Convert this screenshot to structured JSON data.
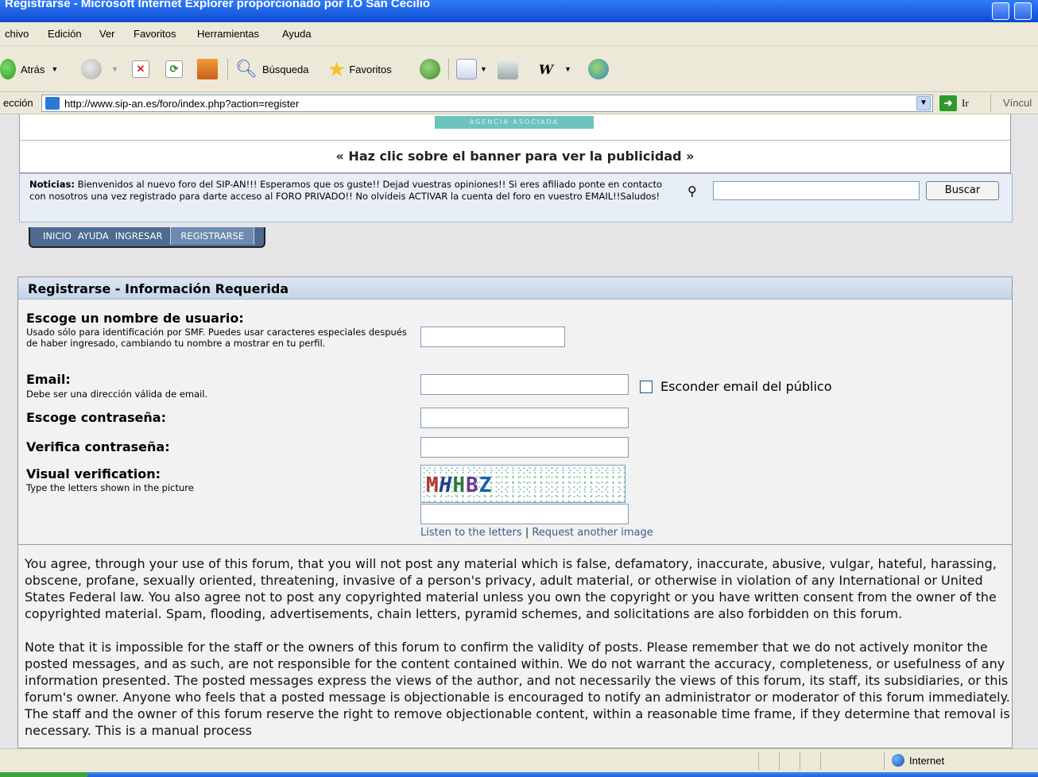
{
  "window": {
    "title": "Registrarse - Microsoft Internet Explorer proporcionado por I.O San Cecilio"
  },
  "menu": [
    "chivo",
    "Edición",
    "Ver",
    "Favoritos",
    "Herramientas",
    "Ayuda"
  ],
  "toolbar": {
    "back": "Atrás",
    "search": "Búsqueda",
    "favorites": "Favoritos"
  },
  "address": {
    "label": "ección",
    "url": "http://www.sip-an.es/foro/index.php?action=register",
    "go": "Ir",
    "links": "Víncul"
  },
  "banner": {
    "strip": "AGENCIA ASOCIADA",
    "message": "« Haz clic sobre el banner para ver la publicidad »"
  },
  "news": {
    "label": "Noticias:",
    "text": " Bienvenidos al nuevo foro del SIP-AN!!! Esperamos que os guste!! Dejad vuestras opiniones!! Si eres afiliado ponte en contacto con nosotros una vez registrado para darte acceso al FORO PRIVADO!! No olvideis ACTIVAR la cuenta del foro en vuestro EMAIL!!Saludos!",
    "search_button": "Buscar"
  },
  "tabs": [
    "INICIO",
    "AYUDA",
    "INGRESAR",
    "REGISTRARSE"
  ],
  "form": {
    "header": "Registrarse - Información Requerida",
    "username": {
      "title": "Escoge un nombre de usuario:",
      "desc": "Usado sólo para identificación por SMF. Puedes usar caracteres especiales después de haber ingresado, cambiando tu nombre a mostrar en tu perfil."
    },
    "email": {
      "title": "Email:",
      "desc": "Debe ser una dirección válida de email.",
      "hide_label": "Esconder email del público"
    },
    "password": {
      "title": "Escoge contraseña:"
    },
    "verify": {
      "title": "Verifica contraseña:"
    },
    "visual": {
      "title": "Visual verification:",
      "desc": "Type the letters shown in the picture",
      "captcha": "MHHBZ"
    },
    "links": {
      "listen": "Listen to the letters",
      "separator": "|",
      "another": "Request another image"
    }
  },
  "agreement": [
    "You agree, through your use of this forum, that you will not post any material which is false, defamatory, inaccurate, abusive, vulgar, hateful, harassing, obscene, profane, sexually oriented, threatening, invasive of a person's privacy, adult material, or otherwise in violation of any International or United States Federal law. You also agree not to post any copyrighted material unless you own the copyright or you have written consent from the owner of the copyrighted material. Spam, flooding, advertisements, chain letters, pyramid schemes, and solicitations are also forbidden on this forum.",
    "Note that it is impossible for the staff or the owners of this forum to confirm the validity of posts. Please remember that we do not actively monitor the posted messages, and as such, are not responsible for the content contained within. We do not warrant the accuracy, completeness, or usefulness of any information presented. The posted messages express the views of the author, and not necessarily the views of this forum, its staff, its subsidiaries, or this forum's owner. Anyone who feels that a posted message is objectionable is encouraged to notify an administrator or moderator of this forum immediately. The staff and the owner of this forum reserve the right to remove objectionable content, within a reasonable time frame, if they determine that removal is necessary. This is a manual process"
  ],
  "status": {
    "zone": "Internet"
  },
  "colors": {
    "tab_bar": "#4d6a91",
    "link": "#3a5a8a",
    "header_bg": "#c6d4e8"
  }
}
